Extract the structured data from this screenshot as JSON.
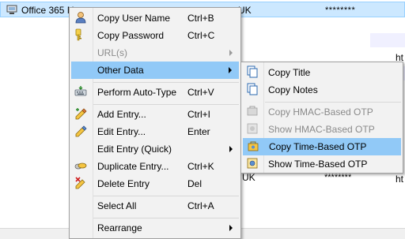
{
  "entry_list": {
    "rows": [
      {
        "title": "Office 365 N",
        "url": "UK",
        "password": "********"
      },
      {
        "url_fragment": "UK",
        "password": "********"
      }
    ],
    "url_prefix_fragment": "ht",
    "menu_fragment_row4": "ht",
    "menu_fragment_row5": "ht",
    "menu_fragment_row7": "ht",
    "menu_fragment_row8": "ht"
  },
  "context_menu": {
    "items": [
      {
        "label": "Copy User Name",
        "shortcut": "Ctrl+B",
        "icon": "user-icon"
      },
      {
        "label": "Copy Password",
        "shortcut": "Ctrl+C",
        "icon": "key-icon"
      },
      {
        "label": "URL(s)",
        "shortcut": "",
        "icon": "",
        "disabled": true
      },
      {
        "label": "Other Data",
        "shortcut": "",
        "icon": "",
        "highlight": true
      },
      {
        "label": "Perform Auto-Type",
        "shortcut": "Ctrl+V",
        "icon": "auto-type-icon"
      },
      {
        "label": "Add Entry...",
        "shortcut": "Ctrl+I",
        "icon": "add-entry-icon"
      },
      {
        "label": "Edit Entry...",
        "shortcut": "Enter",
        "icon": "edit-entry-icon"
      },
      {
        "label": "Edit Entry (Quick)",
        "shortcut": "",
        "icon": ""
      },
      {
        "label": "Duplicate Entry...",
        "shortcut": "Ctrl+K",
        "icon": "duplicate-entry-icon"
      },
      {
        "label": "Delete Entry",
        "shortcut": "Del",
        "icon": "delete-entry-icon"
      },
      {
        "label": "Select All",
        "shortcut": "Ctrl+A",
        "icon": ""
      },
      {
        "label": "Rearrange",
        "shortcut": "",
        "icon": ""
      }
    ]
  },
  "submenu": {
    "items": [
      {
        "label": "Copy Title",
        "icon": "copy-icon"
      },
      {
        "label": "Copy Notes",
        "icon": "copy-icon"
      },
      {
        "label": "Copy HMAC-Based OTP",
        "icon": "hmac-otp-icon",
        "disabled": true
      },
      {
        "label": "Show HMAC-Based OTP",
        "icon": "show-hmac-otp-icon",
        "disabled": true
      },
      {
        "label": "Copy Time-Based OTP",
        "icon": "totp-copy-icon",
        "highlight": true
      },
      {
        "label": "Show Time-Based OTP",
        "icon": "totp-show-icon"
      }
    ]
  },
  "colors": {
    "highlight": "#91c9f7",
    "row_selected": "#cce8ff",
    "menu_bg": "#f2f2f2",
    "disabled_text": "#8a8a8a"
  }
}
